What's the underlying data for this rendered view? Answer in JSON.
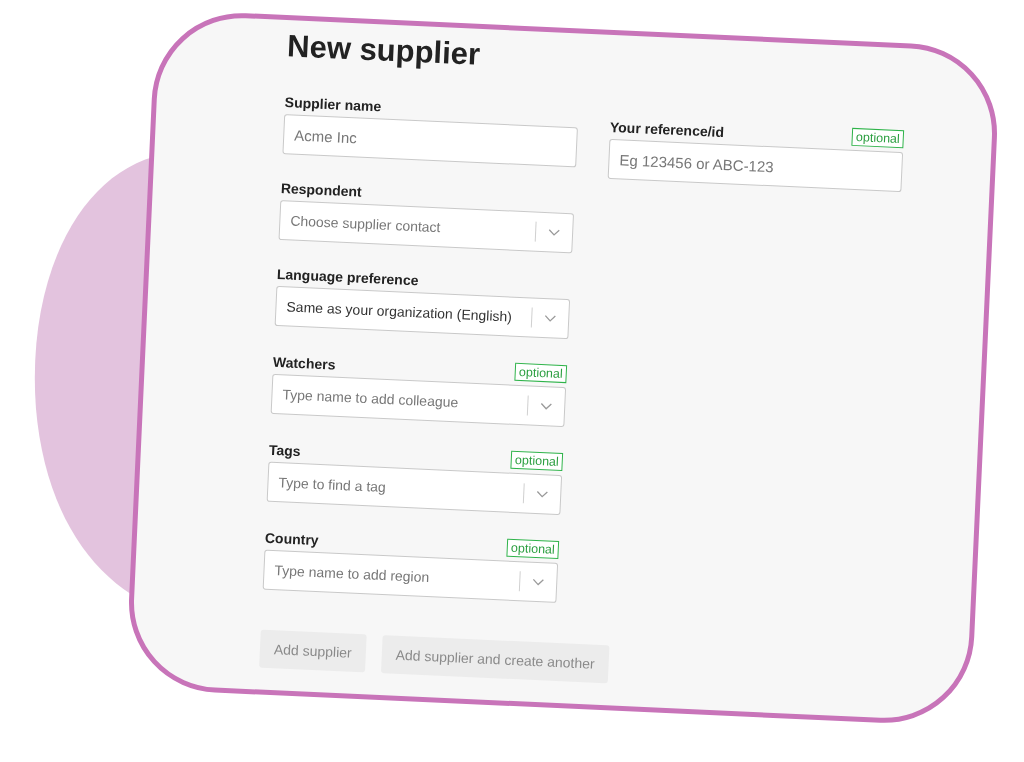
{
  "title": "New supplier",
  "fields": [
    {
      "label": "Supplier name",
      "kind": "text",
      "placeholder": "Acme Inc",
      "optional": false
    },
    {
      "label": "Respondent",
      "kind": "select",
      "placeholder": "Choose supplier contact",
      "optional": false
    },
    {
      "label": "Language preference",
      "kind": "select",
      "value": "Same as your organization (English)",
      "optional": false
    },
    {
      "label": "Watchers",
      "kind": "select",
      "placeholder": "Type name to add colleague",
      "optional": true,
      "optional_label": "optional"
    },
    {
      "label": "Tags",
      "kind": "select",
      "placeholder": "Type to find a tag",
      "optional": true,
      "optional_label": "optional"
    },
    {
      "label": "Country",
      "kind": "select",
      "placeholder": "Type name to add region",
      "optional": true,
      "optional_label": "optional"
    }
  ],
  "side_fields": [
    {
      "label": "Your reference/id",
      "kind": "text",
      "placeholder": "Eg 123456 or ABC-123",
      "optional": true,
      "optional_label": "optional"
    }
  ],
  "buttons": [
    {
      "label": "Add supplier",
      "disabled": true
    },
    {
      "label": "Add supplier and create another",
      "disabled": true
    }
  ]
}
